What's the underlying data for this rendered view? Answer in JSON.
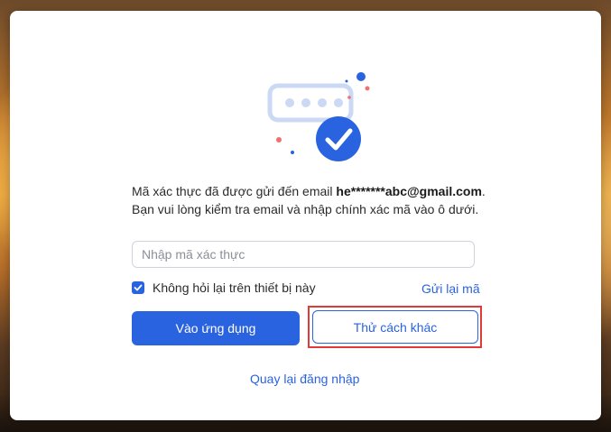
{
  "dialog": {
    "message_prefix": "Mã xác thực đã được gửi đến email",
    "masked_email": "he*******abc@gmail.com",
    "message_suffix": ". Bạn vui lòng kiểm tra email và nhập chính xác mã vào ô dưới.",
    "code_input": {
      "placeholder": "Nhập mã xác thực",
      "value": ""
    },
    "remember_device": {
      "label": "Không hỏi lại trên thiết bị này",
      "checked": true
    },
    "resend_label": "Gửi lại mã",
    "primary_button_label": "Vào ứng dụng",
    "secondary_button_label": "Thử cách khác",
    "back_link_label": "Quay lại đăng nhập"
  },
  "icons": {
    "illustration": "otp-verified-illustration",
    "check": "check-icon"
  },
  "colors": {
    "accent": "#2a63e0",
    "highlight": "#e03a3a",
    "illustration_light": "#cbd9f5",
    "dot_red": "#f07070"
  }
}
